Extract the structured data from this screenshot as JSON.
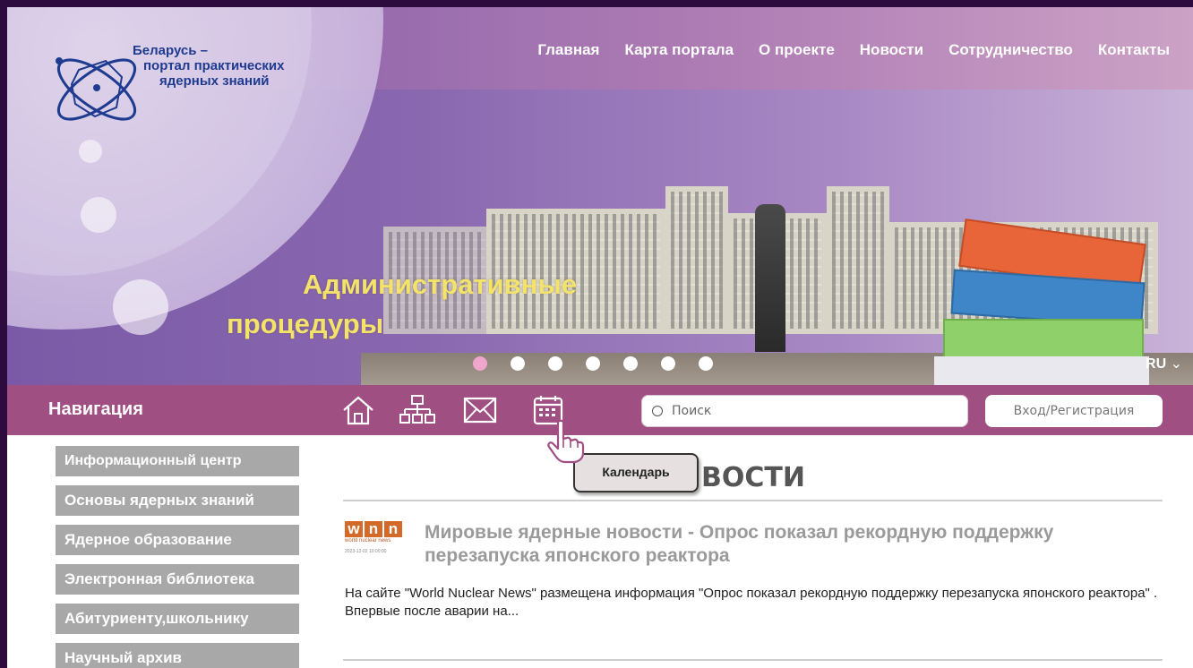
{
  "logo": {
    "line1": "Беларусь –",
    "line2": "портал практических",
    "line3": "ядерных знаний",
    "color": "#1f3b8f"
  },
  "topnav": [
    "Главная",
    "Карта портала",
    "О проекте",
    "Новости",
    "Сотрудничество",
    "Контакты"
  ],
  "slider": {
    "slogan_line1": "Административные",
    "slogan_line2": "процедуры",
    "dot_count": 7,
    "active_dot": 0,
    "language": "RU"
  },
  "toolbar": {
    "nav_title": "Навигация",
    "icons": [
      "home-icon",
      "sitemap-icon",
      "mail-icon",
      "calendar-icon"
    ],
    "search_placeholder": "Поиск",
    "login_label": "Вход/Регистрация",
    "bg_color": "#a04f82"
  },
  "tooltip": "Календарь",
  "sidebar": {
    "items": [
      "Информационный центр",
      "Основы ядерных знаний",
      "Ядерное образование",
      "Электронная библиотека",
      "Абитуриенту,школьнику",
      "Научный архив"
    ]
  },
  "news": {
    "heading_partial": "ВОСТИ",
    "source_logo": "wnn",
    "source_sub": "world nuclear news",
    "source_date": "2023-12-02 10:00:00",
    "article_title": "Мировые ядерные новости - Опрос показал рекордную поддержку перезапуска японского реактора",
    "article_body": "На сайте \"World Nuclear News\" размещена информация \"Опрос показал рекордную поддержку перезапуска японского реактора\" . Впервые после аварии на..."
  }
}
